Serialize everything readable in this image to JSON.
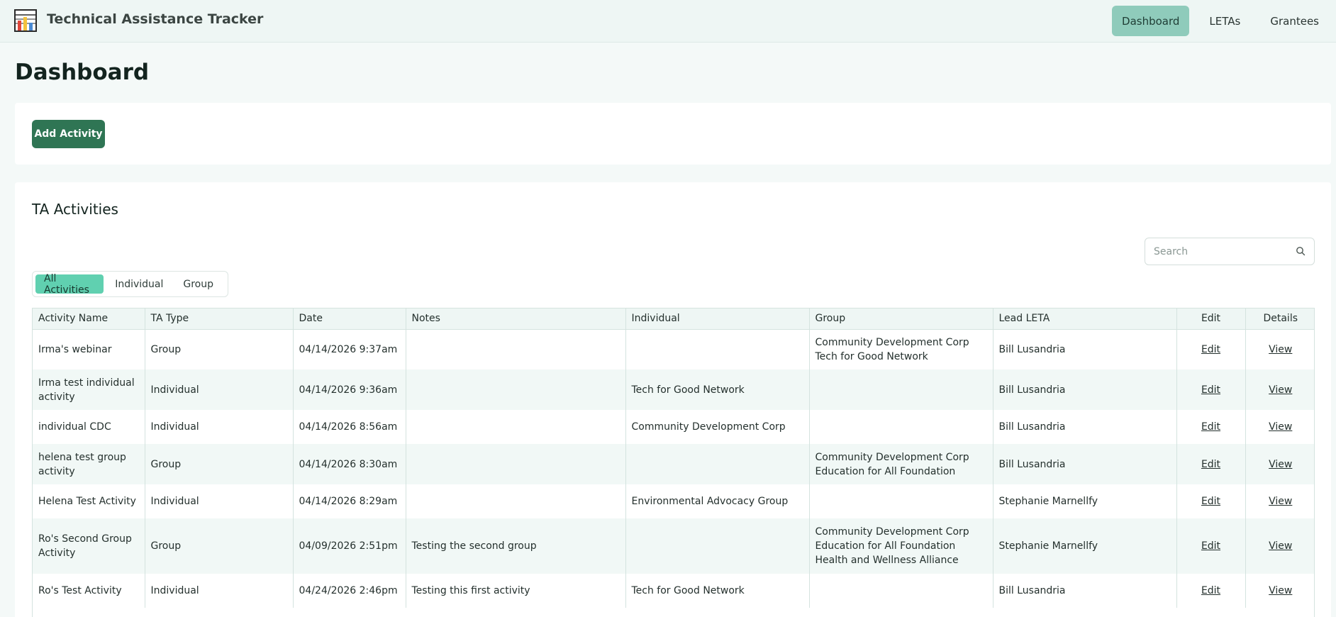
{
  "app": {
    "title": "Technical Assistance Tracker",
    "logo_icon": "bar-chart-icon"
  },
  "nav": {
    "items": [
      {
        "label": "Dashboard",
        "active": true
      },
      {
        "label": "LETAs",
        "active": false
      },
      {
        "label": "Grantees",
        "active": false
      }
    ]
  },
  "page": {
    "title": "Dashboard"
  },
  "actions": {
    "add_label": "Add Activity"
  },
  "activities": {
    "title": "TA Activities",
    "search_placeholder": "Search",
    "filters": [
      {
        "label": "All Activities",
        "active": true
      },
      {
        "label": "Individual",
        "active": false
      },
      {
        "label": "Group",
        "active": false
      }
    ],
    "columns": [
      "Activity Name",
      "TA Type",
      "Date",
      "Notes",
      "Individual",
      "Group",
      "Lead LETA",
      "Edit",
      "Details"
    ],
    "rows": [
      {
        "name": "Irma's webinar",
        "type": "Group",
        "date": "04/14/2026 9:37am",
        "notes": "",
        "individual": "",
        "groups": [
          "Community Development Corp",
          "Tech for Good Network"
        ],
        "lead": "Bill Lusandria",
        "edit": "Edit",
        "view": "View"
      },
      {
        "name": "Irma test individual activity",
        "type": "Individual",
        "date": "04/14/2026 9:36am",
        "notes": "",
        "individual": "Tech for Good Network",
        "groups": [],
        "lead": "Bill Lusandria",
        "edit": "Edit",
        "view": "View"
      },
      {
        "name": "individual CDC",
        "type": "Individual",
        "date": "04/14/2026 8:56am",
        "notes": "",
        "individual": "Community Development Corp",
        "groups": [],
        "lead": "Bill Lusandria",
        "edit": "Edit",
        "view": "View"
      },
      {
        "name": "helena test group activity",
        "type": "Group",
        "date": "04/14/2026 8:30am",
        "notes": "",
        "individual": "",
        "groups": [
          "Community Development Corp",
          "Education for All Foundation"
        ],
        "lead": "Bill Lusandria",
        "edit": "Edit",
        "view": "View"
      },
      {
        "name": "Helena Test Activity",
        "type": "Individual",
        "date": "04/14/2026 8:29am",
        "notes": "",
        "individual": "Environmental Advocacy Group",
        "groups": [],
        "lead": "Stephanie Marnellfy",
        "edit": "Edit",
        "view": "View"
      },
      {
        "name": "Ro's Second Group Activity",
        "type": "Group",
        "date": "04/09/2026 2:51pm",
        "notes": "Testing the second group",
        "individual": "",
        "groups": [
          "Community Development Corp",
          "Education for All Foundation",
          "Health and Wellness Alliance"
        ],
        "lead": "Stephanie Marnellfy",
        "edit": "Edit",
        "view": "View"
      },
      {
        "name": "Ro's Test Activity",
        "type": "Individual",
        "date": "04/24/2026 2:46pm",
        "notes": "Testing this first activity",
        "individual": "Tech for Good Network",
        "groups": [],
        "lead": "Bill Lusandria",
        "edit": "Edit",
        "view": "View"
      }
    ]
  },
  "colors": {
    "accent": "#2f7554",
    "nav_active": "#8fcbbb",
    "filter_active": "#60d0b0",
    "row_alt": "#f1f8f6"
  }
}
